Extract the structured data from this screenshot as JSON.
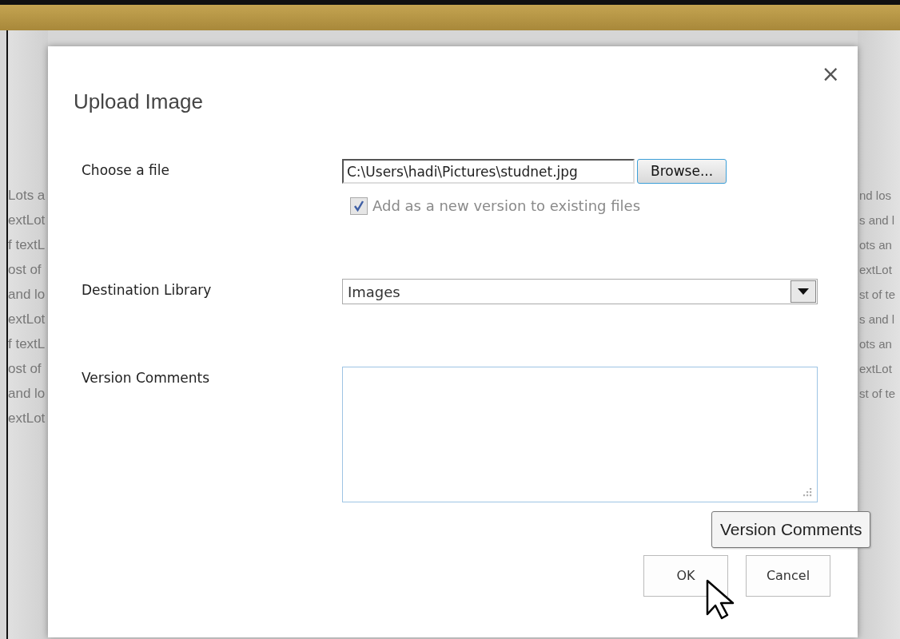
{
  "background": {
    "left_fragments": [
      "Lots a",
      "extLot",
      "f textL",
      "ost of",
      "and lo",
      "extLot",
      "f textL",
      "ost of",
      "and lo",
      "extLot"
    ],
    "right_fragments": [
      "nd los",
      "s and l",
      "ots an",
      "extLot",
      "st of te",
      "s and l",
      "ots an",
      "extLot",
      "st of te"
    ]
  },
  "dialog": {
    "title": "Upload Image",
    "close": "×",
    "fields": [
      {
        "kind": "file",
        "label": "Choose a file",
        "value": "C:\\Users\\hadi\\Pictures\\studnet.jpg",
        "button": "Browse...",
        "checkbox": {
          "label": "Add as a new version to existing files",
          "checked": true,
          "disabled": true
        }
      },
      {
        "kind": "select",
        "label": "Destination Library",
        "value": "Images"
      },
      {
        "kind": "textarea",
        "label": "Version Comments"
      }
    ],
    "tooltip": "Version Comments",
    "buttons": [
      "OK",
      "Cancel"
    ]
  }
}
